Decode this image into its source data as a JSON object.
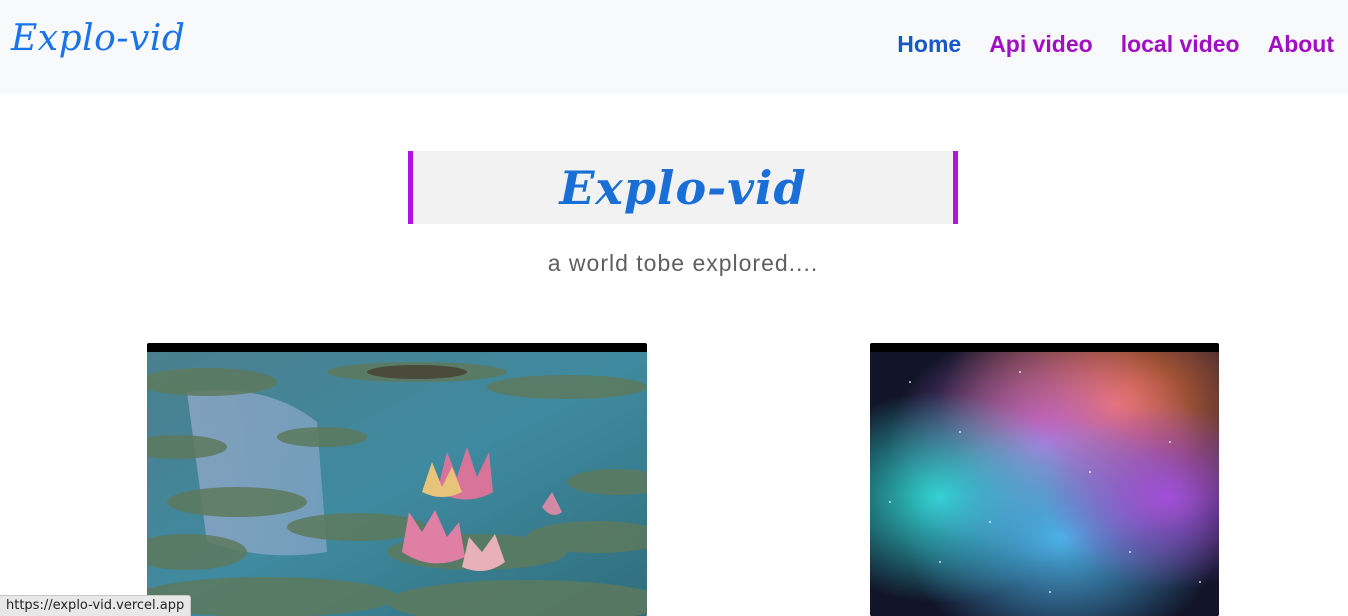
{
  "navbar": {
    "brand": "Explo-vid",
    "links": [
      {
        "label": "Home",
        "color": "#1558c6"
      },
      {
        "label": "Api video",
        "color": "#a00fc2"
      },
      {
        "label": "local video",
        "color": "#a00fc2"
      },
      {
        "label": "About",
        "color": "#a00fc2"
      }
    ]
  },
  "hero": {
    "title": "Explo-vid",
    "tagline": "a world tobe explored....",
    "accent_color": "#b312e6"
  },
  "videos": [
    {
      "subject": "water lilies on a pond"
    },
    {
      "subject": "colorful nebula in space"
    }
  ],
  "status_bar": {
    "url": "https://explo-vid.vercel.app"
  }
}
